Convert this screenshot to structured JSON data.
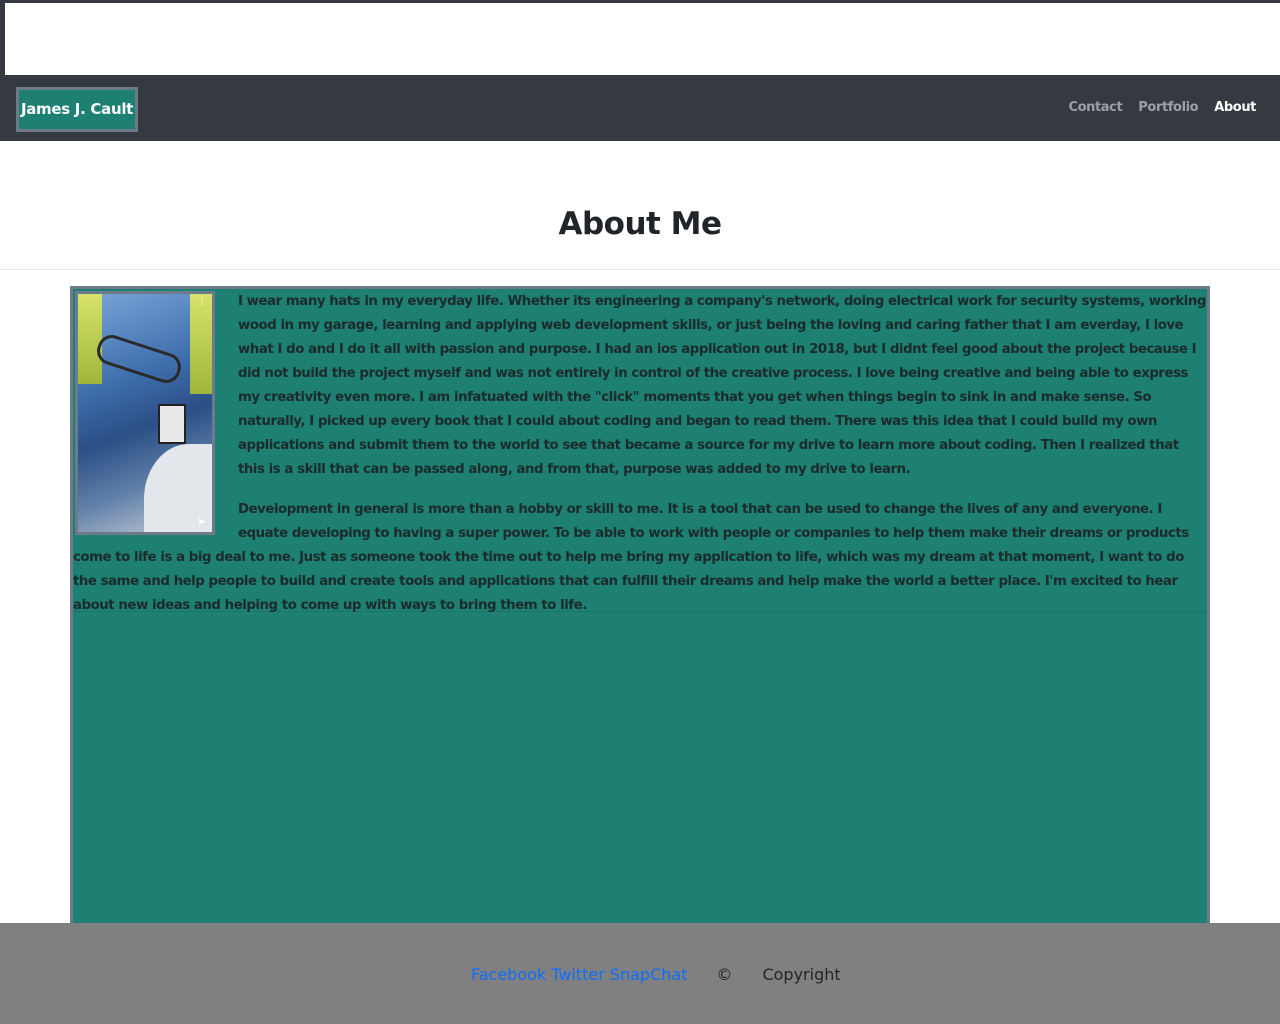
{
  "navbar": {
    "brand": "James J. Cault",
    "links": [
      {
        "label": "Contact",
        "active": false
      },
      {
        "label": "Portfolio",
        "active": false
      },
      {
        "label": "About",
        "active": true
      }
    ]
  },
  "page": {
    "title": "About Me"
  },
  "about": {
    "paragraphs": [
      "I wear many hats in my everyday life. Whether its engineering a company's network, doing electrical work for security systems, working wood in my garage, learning and applying web development skills, or just being the loving and caring father that I am everday, I love what I do and I do it all with passion and purpose. I had an ios application out in 2018, but I didnt feel good about the project because I did not build the project myself and was not entirely in control of the creative process. I love being creative and being able to express my creativity even more. I am infatuated with the \"click\" moments that you get when things begin to sink in and make sense. So naturally, I picked up every book that I could about coding and began to read them. There was this idea that I could build my own applications and submit them to the world to see that became a source for my drive to learn more about coding. Then I realized that this is a skill that can be passed along, and from that, purpose was added to my drive to learn.",
      "Development in general is more than a hobby or skill to me. It is a tool that can be used to change the lives of any and everyone. I equate developing to having a super power. To be able to work with people or companies to help them make their dreams or products come to life is a big deal to me. Just as someone took the time out to help me bring my application to life, which was my dream at that moment, I want to do the same and help people to build and create tools and applications that can fulfill their dreams and help make the world a better place. I'm excited to hear about new ideas and helping to come up with ways to bring them to life."
    ]
  },
  "footer": {
    "social_links": [
      "Facebook",
      "Twitter",
      "SnapChat"
    ],
    "copyright_symbol": "©",
    "copyright_text": "Copyright"
  },
  "colors": {
    "navbar_bg": "#343a40",
    "accent_teal": "#1e7f73",
    "border_gray": "#6c7a89",
    "footer_bg": "#808080",
    "link_blue": "#0d6efd"
  }
}
